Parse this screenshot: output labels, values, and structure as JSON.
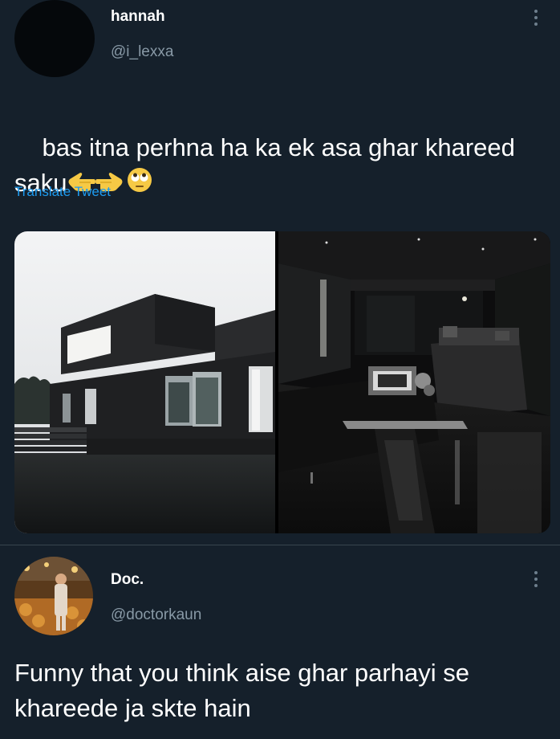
{
  "tweet1": {
    "display_name": "hannah",
    "handle": "@i_lexxa",
    "text": "bas itna perhna ha ka ek asa ghar khareed\nsaku",
    "emojis": [
      "backhand-index-pointing-left",
      "backhand-index-pointing-right",
      "face-with-rolling-eyes"
    ],
    "translate_label": "Translate Tweet",
    "media": [
      {
        "name": "dark-modern-house-exterior-photo"
      },
      {
        "name": "dark-living-room-interior-photo"
      }
    ]
  },
  "tweet2": {
    "display_name": "Doc.",
    "handle": "@doctorkaun",
    "text": "Funny that you think aise ghar parhayi se\nkhareede ja skte hain"
  },
  "colors": {
    "background": "#15202b",
    "secondary_text": "#8899a6",
    "link": "#1d9bf0",
    "divider": "#38444d"
  }
}
